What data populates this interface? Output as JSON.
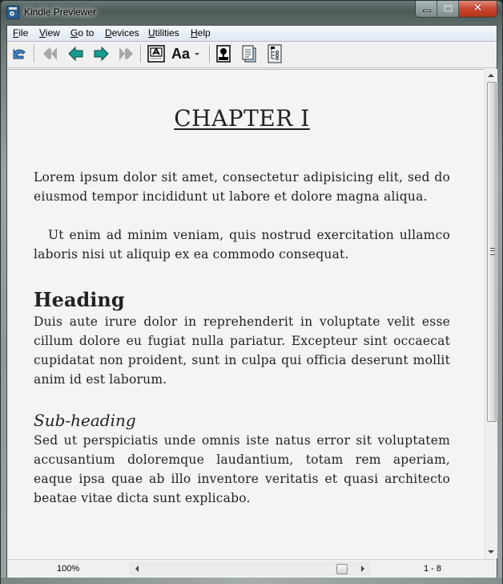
{
  "window": {
    "title": "Kindle Previewer",
    "app_icon": "kindle-previewer-icon",
    "controls": {
      "minimize": "minimize-icon",
      "maximize": "maximize-icon",
      "close": "close-icon",
      "close_glyph": "✕"
    }
  },
  "menu": {
    "items": [
      {
        "label": "File",
        "accel": "F",
        "rest": "ile"
      },
      {
        "label": "View",
        "accel": "V",
        "rest": "iew"
      },
      {
        "label": "Go to",
        "accel": "G",
        "rest": "o to"
      },
      {
        "label": "Devices",
        "accel": "D",
        "rest": "evices"
      },
      {
        "label": "Utilities",
        "accel": "U",
        "rest": "tilities"
      },
      {
        "label": "Help",
        "accel": "H",
        "rest": "elp"
      }
    ]
  },
  "toolbar": {
    "buttons": [
      {
        "name": "rotate-back",
        "icon": "undo-rotate-icon",
        "enabled": true
      },
      {
        "name": "first-page",
        "icon": "double-left-arrow-icon",
        "enabled": false
      },
      {
        "name": "previous-page",
        "icon": "left-arrow-icon",
        "enabled": true
      },
      {
        "name": "next-page",
        "icon": "right-arrow-icon",
        "enabled": true
      },
      {
        "name": "last-page",
        "icon": "double-right-arrow-icon",
        "enabled": false
      },
      {
        "name": "display-mode",
        "icon": "font-display-icon",
        "enabled": true
      },
      {
        "name": "font-size",
        "icon": "font-size-icon",
        "label": "Aa",
        "enabled": true
      },
      {
        "name": "cover",
        "icon": "cover-image-icon",
        "enabled": true
      },
      {
        "name": "book-content",
        "icon": "pages-icon",
        "enabled": true
      },
      {
        "name": "toc",
        "icon": "table-of-contents-icon",
        "enabled": true
      }
    ]
  },
  "document": {
    "chapter_title": "CHAPTER I",
    "paragraphs": {
      "p1": "Lorem ipsum dolor sit amet, consectetur adipisicing elit, sed do eiusmod tempor incididunt ut labore et dolore magna aliqua.",
      "p2": "Ut enim ad minim veniam, quis nostrud exercitation ullamco laboris nisi ut aliquip ex ea commodo consequat.",
      "heading": "Heading",
      "p3": "Duis aute irure dolor in reprehenderit in voluptate velit esse cillum dolore eu fugiat nulla pariatur. Excepteur sint occaecat cupidatat non proident, sunt in culpa qui officia deserunt mollit anim id est laborum.",
      "subheading": "Sub-heading",
      "p4": "Sed ut perspiciatis unde omnis iste natus error sit voluptatem accusantium doloremque laudantium, totam rem aperiam, eaque ipsa quae ab illo inventore veritatis et quasi architecto beatae vitae dicta sunt explicabo."
    }
  },
  "status": {
    "zoom": "100%",
    "page_range": "1 - 8",
    "page_slider_position": 0.95
  },
  "colors": {
    "teal_arrow": "#1b9a8e",
    "disabled_arrow": "#a8a8a8",
    "close_red": "#c8452f"
  }
}
